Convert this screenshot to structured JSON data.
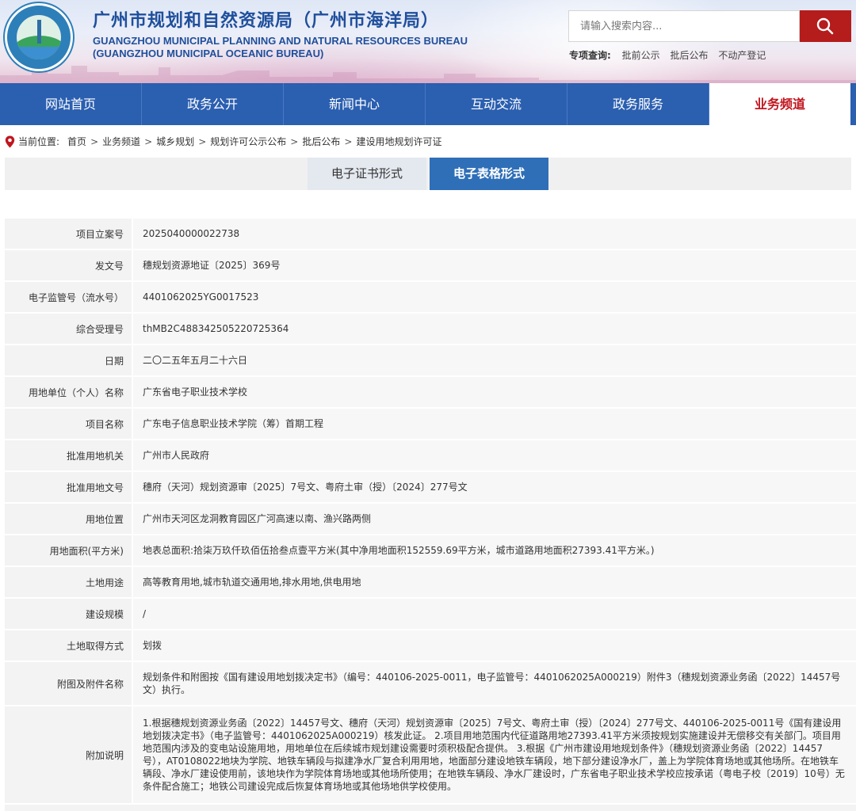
{
  "header": {
    "title_cn": "广州市规划和自然资源局（广州市海洋局）",
    "title_en_line1": "GUANGZHOU MUNICIPAL PLANNING AND NATURAL RESOURCES BUREAU",
    "title_en_line2": "(GUANGZHOU MUNICIPAL OCEANIC BUREAU)",
    "search": {
      "placeholder": "请输入搜索内容..."
    },
    "quick_query": {
      "label": "专项查询:",
      "links": [
        "批前公示",
        "批后公布",
        "不动产登记"
      ]
    }
  },
  "nav": {
    "items": [
      "网站首页",
      "政务公开",
      "新闻中心",
      "互动交流",
      "政务服务",
      "业务频道"
    ],
    "active": "业务频道"
  },
  "breadcrumb": {
    "label": "当前位置:",
    "items": [
      "首页",
      "业务频道",
      "城乡规划",
      "规划许可公示公布",
      "批后公布",
      "建设用地规划许可证"
    ]
  },
  "tabs": [
    "电子证书形式",
    "电子表格形式"
  ],
  "table": {
    "rows": [
      {
        "k": "项目立案号",
        "v": "2025040000022738"
      },
      {
        "k": "发文号",
        "v": "穗规划资源地证〔2025〕369号"
      },
      {
        "k": "电子监管号（流水号）",
        "v": "4401062025YG0017523"
      },
      {
        "k": "综合受理号",
        "v": "thMB2C488342505220725364"
      },
      {
        "k": "日期",
        "v": "二〇二五年五月二十六日"
      },
      {
        "k": "用地单位（个人）名称",
        "v": "广东省电子职业技术学校"
      },
      {
        "k": "项目名称",
        "v": "广东电子信息职业技术学院（筹）首期工程"
      },
      {
        "k": "批准用地机关",
        "v": "广州市人民政府"
      },
      {
        "k": "批准用地文号",
        "v": "穗府（天河）规划资源审〔2025〕7号文、粤府土审（授）〔2024〕277号文"
      },
      {
        "k": "用地位置",
        "v": "广州市天河区龙洞教育园区广河高速以南、渔兴路两侧"
      },
      {
        "k": "用地面积(平方米)",
        "v": "地表总面积:拾柒万玖仟玖佰伍拾叁点壹平方米(其中净用地面积152559.69平方米，城市道路用地面积27393.41平方米。)"
      },
      {
        "k": "土地用途",
        "v": "高等教育用地,城市轨道交通用地,排水用地,供电用地"
      },
      {
        "k": "建设规模",
        "v": "/"
      },
      {
        "k": "土地取得方式",
        "v": "划拨"
      },
      {
        "k": "附图及附件名称",
        "v": "规划条件和附图按《国有建设用地划拨决定书》（编号：440106-2025-0011，电子监管号：4401062025A000219）附件3（穗规划资源业务函〔2022〕14457号文）执行。"
      },
      {
        "k": "附加说明",
        "v": "1.根据穗规划资源业务函〔2022〕14457号文、穗府（天河）规划资源审〔2025〕7号文、粤府土审（授）〔2024〕277号文、440106-2025-0011号《国有建设用地划拨决定书》（电子监管号：4401062025A000219）核发此证。 2.项目用地范围内代征道路用地27393.41平方米须按规划实施建设并无偿移交有关部门。项目用地范围内涉及的变电站设施用地，用地单位在后续城市规划建设需要时须积极配合提供。 3.根据《广州市建设用地规划条件》（穗规划资源业务函〔2022〕14457号），AT0108022地块为学院、地铁车辆段与拟建净水厂复合利用用地，地面部分建设地铁车辆段，地下部分建设净水厂，盖上为学院体育场地或其他场所。在地铁车辆段、净水厂建设使用前，该地块作为学院体育场地或其他场所使用；在地铁车辆段、净水厂建设时，广东省电子职业技术学校应按承诺（粤电子校〔2019〕10号）无条件配合施工；地铁公司建设完成后恢复体育场地或其他场地供学校使用。"
      }
    ]
  }
}
